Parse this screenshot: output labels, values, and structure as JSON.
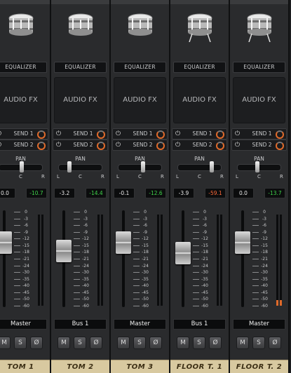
{
  "channels": [
    {
      "name": "TOM 1",
      "eq_label": "EQUALIZER",
      "fx_label": "AUDIO FX",
      "send1": "SEND 1",
      "send2": "SEND 2",
      "pan_label": "PAN",
      "pan_l": "L",
      "pan_c": "C",
      "pan_r": "R",
      "pan_value": 0.5,
      "volume": "0.0",
      "peak": "-10.7",
      "peak_hot": false,
      "fader_level": 0.72,
      "meter_level": 0.0,
      "output": "Master",
      "mute": "M",
      "solo": "S",
      "phase": "Ø",
      "drum_type": "tom"
    },
    {
      "name": "TOM 2",
      "eq_label": "EQUALIZER",
      "fx_label": "AUDIO FX",
      "send1": "SEND 1",
      "send2": "SEND 2",
      "pan_label": "PAN",
      "pan_l": "L",
      "pan_c": "C",
      "pan_r": "R",
      "pan_value": 0.25,
      "volume": "-3.2",
      "peak": "-14.4",
      "peak_hot": false,
      "fader_level": 0.6,
      "meter_level": 0.0,
      "output": "Bus 1",
      "mute": "M",
      "solo": "S",
      "phase": "Ø",
      "drum_type": "tom"
    },
    {
      "name": "TOM 3",
      "eq_label": "EQUALIZER",
      "fx_label": "AUDIO FX",
      "send1": "SEND 1",
      "send2": "SEND 2",
      "pan_label": "PAN",
      "pan_l": "L",
      "pan_c": "C",
      "pan_r": "R",
      "pan_value": 0.55,
      "volume": "-0.1",
      "peak": "-12.6",
      "peak_hot": false,
      "fader_level": 0.72,
      "meter_level": 0.0,
      "output": "Master",
      "mute": "M",
      "solo": "S",
      "phase": "Ø",
      "drum_type": "tom"
    },
    {
      "name": "FLOOR T. 1",
      "eq_label": "EQUALIZER",
      "fx_label": "AUDIO FX",
      "send1": "SEND 1",
      "send2": "SEND 2",
      "pan_label": "PAN",
      "pan_l": "L",
      "pan_c": "C",
      "pan_r": "R",
      "pan_value": 0.75,
      "volume": "-3.9",
      "peak": "-59.1",
      "peak_hot": true,
      "fader_level": 0.58,
      "meter_level": 0.0,
      "output": "Bus 1",
      "mute": "M",
      "solo": "S",
      "phase": "Ø",
      "drum_type": "floor"
    },
    {
      "name": "FLOOR T. 2",
      "eq_label": "EQUALIZER",
      "fx_label": "AUDIO FX",
      "send1": "SEND 1",
      "send2": "SEND 2",
      "pan_label": "PAN",
      "pan_l": "L",
      "pan_c": "C",
      "pan_r": "R",
      "pan_value": 0.45,
      "volume": "0.0",
      "peak": "-13.7",
      "peak_hot": false,
      "fader_level": 0.72,
      "meter_level": 0.06,
      "output": "Master",
      "mute": "M",
      "solo": "S",
      "phase": "Ø",
      "drum_type": "floor"
    }
  ],
  "scale_ticks": [
    "0",
    "-3",
    "-6",
    "-9",
    "-12",
    "-15",
    "-18",
    "-21",
    "-24",
    "-30",
    "-35",
    "-40",
    "-45",
    "-50",
    "-60"
  ],
  "colors": {
    "peak_green": "#3fd24a",
    "peak_hot": "#ff6a3a",
    "send_knob": "#e06a2a",
    "name_plate": "#d8c9a0"
  },
  "icons": {
    "send_power": "power-icon",
    "send_knob": "send-level-knob"
  }
}
